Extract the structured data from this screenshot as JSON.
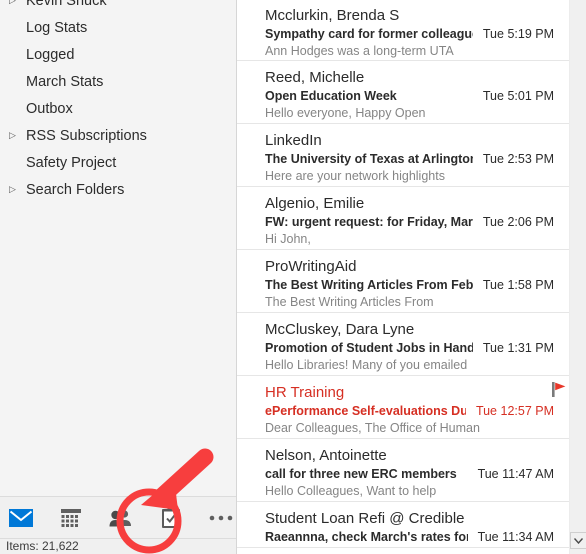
{
  "accent": {
    "mail_blue": "#0078d7",
    "unread_red": "#d62f23",
    "annotation_red": "#f73e3e",
    "flag_red": "#e8382a",
    "icon_gray": "#5f5f5f"
  },
  "sidebar": {
    "items": [
      {
        "label": "Kevin Shuck",
        "expandable": true,
        "partial": true
      },
      {
        "label": "Log Stats",
        "expandable": false,
        "partial": false
      },
      {
        "label": "Logged",
        "expandable": false,
        "partial": false
      },
      {
        "label": "March Stats",
        "expandable": false,
        "partial": false
      },
      {
        "label": "Outbox",
        "expandable": false,
        "partial": false
      },
      {
        "label": "RSS Subscriptions",
        "expandable": true,
        "partial": false
      },
      {
        "label": "Safety Project",
        "expandable": false,
        "partial": false
      },
      {
        "label": "Search Folders",
        "expandable": true,
        "partial": false
      }
    ],
    "expand_glyph": "▷"
  },
  "navbar": {
    "buttons": [
      {
        "name": "mail-icon",
        "label": "Mail"
      },
      {
        "name": "calendar-icon",
        "label": "Calendar"
      },
      {
        "name": "people-icon",
        "label": "People"
      },
      {
        "name": "tasks-icon",
        "label": "Tasks"
      },
      {
        "name": "more-options-icon",
        "label": "More"
      }
    ]
  },
  "statusbar": {
    "items_text": "Items: 21,622"
  },
  "maillist": {
    "messages": [
      {
        "sender": "Mcclurkin, Brenda S",
        "subject": "Sympathy card for former colleague A…",
        "time": "Tue 5:19 PM",
        "preview": "Ann Hodges was a long-term UTA",
        "unread": false,
        "flagged": false
      },
      {
        "sender": "Reed, Michelle",
        "subject": "Open Education Week",
        "time": "Tue 5:01 PM",
        "preview": "Hello everyone,  Happy Open",
        "unread": false,
        "flagged": false
      },
      {
        "sender": "LinkedIn",
        "subject": "The University of Texas at Arlington a…",
        "time": "Tue 2:53 PM",
        "preview": "Here are your network highlights",
        "unread": false,
        "flagged": false
      },
      {
        "sender": "Algenio, Emilie",
        "subject": "FW: urgent request: for Friday, March…",
        "time": "Tue 2:06 PM",
        "preview": "Hi John,",
        "unread": false,
        "flagged": false
      },
      {
        "sender": "ProWritingAid",
        "subject": "The Best Writing Articles From February",
        "time": "Tue 1:58 PM",
        "preview": "The Best Writing Articles From",
        "unread": false,
        "flagged": false
      },
      {
        "sender": "McCluskey, Dara Lyne",
        "subject": "Promotion of Student Jobs in Handsh…",
        "time": "Tue 1:31 PM",
        "preview": "Hello Libraries!  Many of you emailed",
        "unread": false,
        "flagged": false
      },
      {
        "sender": "HR Training",
        "subject": "ePerformance Self-evaluations Due M…",
        "time": "Tue 12:57 PM",
        "preview": "Dear Colleagues,  The Office of Human",
        "unread": true,
        "flagged": true
      },
      {
        "sender": "Nelson, Antoinette",
        "subject": "call for three new ERC members",
        "time": "Tue 11:47 AM",
        "preview": "Hello Colleagues,  Want to help",
        "unread": false,
        "flagged": false
      },
      {
        "sender": "Student Loan Refi @ Credible",
        "subject": "Raeannna, check March's rates for ref…",
        "time": "Tue 11:34 AM",
        "preview": "",
        "unread": false,
        "flagged": false
      }
    ]
  },
  "annotation": {
    "circle_target": "tasks-icon",
    "arrow_direction": "down-left"
  }
}
